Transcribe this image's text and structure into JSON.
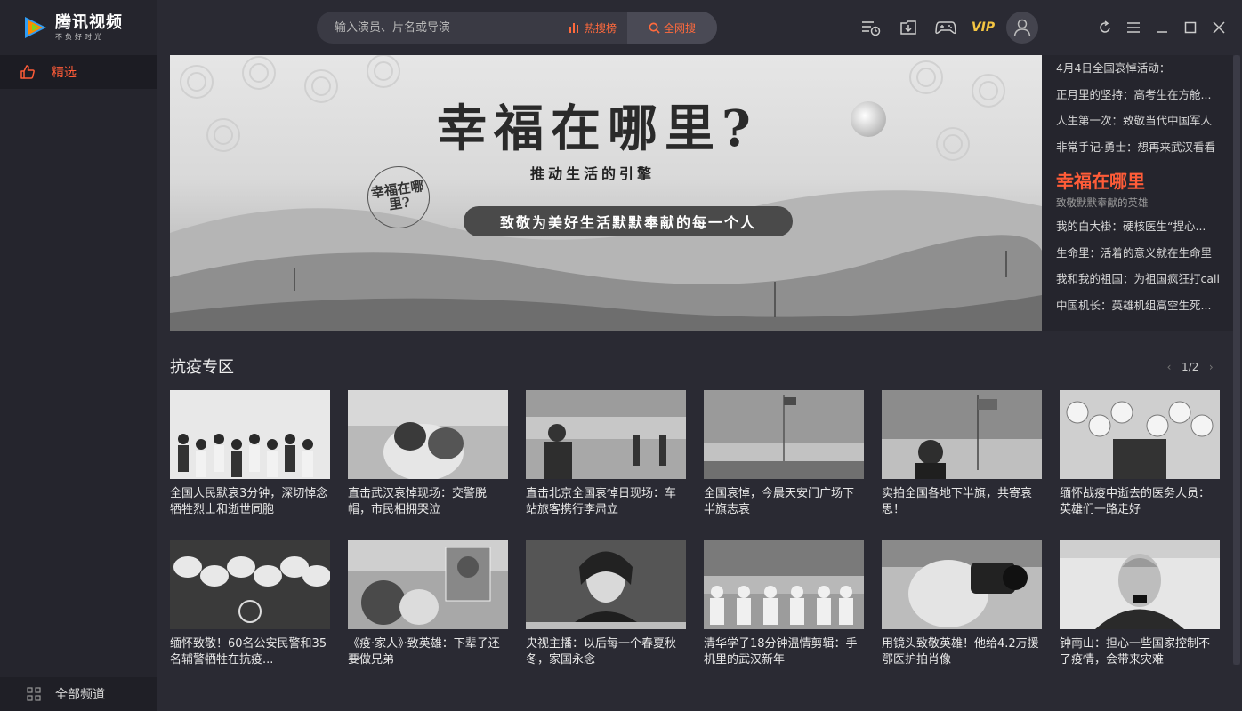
{
  "app": {
    "logo_title": "腾讯视频",
    "logo_slogan": "不负好时光"
  },
  "sidebar": {
    "items": [
      {
        "label": "精选",
        "icon": "thumbs-up-icon"
      }
    ],
    "all_channels_label": "全部频道"
  },
  "search": {
    "placeholder": "输入演员、片名或导演",
    "hot_label": "热搜榜",
    "all_label": "全网搜"
  },
  "toolbar": {
    "vip_label": "VIP"
  },
  "banner": {
    "title": "幸福在哪里?",
    "subtitle": "推动生活的引擎",
    "ribbon": "致敬为美好生活默默奉献的每一个人",
    "seal": "幸福在哪里?"
  },
  "right_list": {
    "top": [
      "4月4日全国哀悼活动：",
      "正月里的坚持：高考生在方舱...",
      "人生第一次：致敬当代中国军人",
      "非常手记·勇士：想再来武汉看看"
    ],
    "feature_title": "幸福在哪里",
    "feature_sub": "致敬默默奉献的英雄",
    "bottom": [
      "我的白大褂：硬核医生“捏心...",
      "生命里：活着的意义就在生命里",
      "我和我的祖国：为祖国疯狂打call",
      "中国机长：英雄机组高空生死..."
    ]
  },
  "section": {
    "title": "抗疫专区",
    "page": "1",
    "page_sep": "/",
    "total": "2"
  },
  "cards": [
    {
      "title": "全国人民默哀3分钟，深切悼念牺牲烈士和逝世同胞"
    },
    {
      "title": "直击武汉哀悼现场：交警脱帽，市民相拥哭泣"
    },
    {
      "title": "直击北京全国哀悼日现场：车站旅客携行李肃立"
    },
    {
      "title": "全国哀悼，今晨天安门广场下半旗志哀"
    },
    {
      "title": "实拍全国各地下半旗，共寄哀思！"
    },
    {
      "title": "缅怀战疫中逝去的医务人员：英雄们一路走好"
    },
    {
      "title": "缅怀致敬！60名公安民警和35名辅警牺牲在抗疫..."
    },
    {
      "title": "《疫·家人》·致英雄：下辈子还要做兄弟"
    },
    {
      "title": "央视主播：以后每一个春夏秋冬，家国永念"
    },
    {
      "title": "清华学子18分钟温情剪辑：手机里的武汉新年"
    },
    {
      "title": "用镜头致敬英雄！他给4.2万援鄂医护拍肖像"
    },
    {
      "title": "钟南山：担心一些国家控制不了疫情，会带来灾难"
    }
  ],
  "colors": {
    "accent": "#ff5c38",
    "vip": "#f4c542",
    "bg": "#2a2a33",
    "sidebar": "#25252d"
  }
}
